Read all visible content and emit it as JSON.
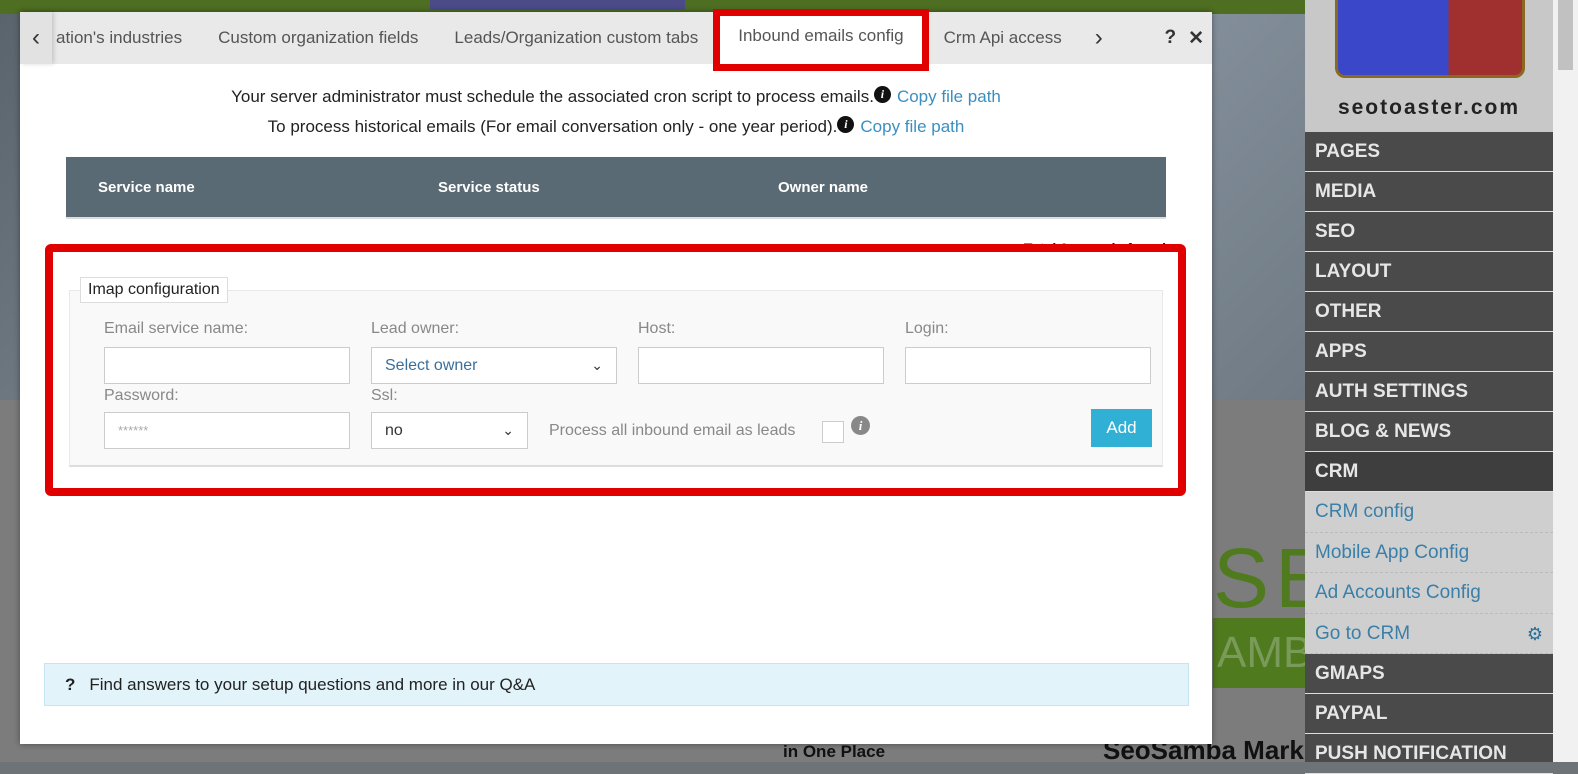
{
  "tabs": {
    "items": [
      "ation's industries",
      "Custom organization fields",
      "Leads/Organization custom tabs",
      "Inbound emails config",
      "Crm Api access"
    ],
    "active": "Inbound emails config",
    "help": "?",
    "close": "✕"
  },
  "info": {
    "line1": "Your server administrator must schedule the associated cron script to process emails.",
    "line2": "To process historical emails (For email conversation only - one year period).",
    "link": "Copy file path",
    "icon": "info-icon"
  },
  "table": {
    "headers": [
      "Service name",
      "Service status",
      "Owner name"
    ],
    "records": "Total 0 records found"
  },
  "imap": {
    "legend": "Imap configuration",
    "email_service_label": "Email service name:",
    "email_service_value": "",
    "lead_owner_label": "Lead owner:",
    "lead_owner_value": "Select owner",
    "host_label": "Host:",
    "host_value": "",
    "login_label": "Login:",
    "login_value": "",
    "password_label": "Password:",
    "password_value": "******",
    "ssl_label": "Ssl:",
    "ssl_value": "no",
    "process_label": "Process all inbound email as leads",
    "process_checked": false,
    "add": "Add"
  },
  "qa": {
    "icon": "?",
    "text": "Find answers to your setup questions and more in our Q&A"
  },
  "sidebar": {
    "logo": "seotoaster.com",
    "items": [
      "PAGES",
      "MEDIA",
      "SEO",
      "LAYOUT",
      "OTHER",
      "APPS",
      "AUTH SETTINGS",
      "BLOG & NEWS",
      "CRM"
    ],
    "crm_sub": [
      "CRM config",
      "Mobile App Config",
      "Ad Accounts Config",
      "Go to CRM"
    ],
    "items2": [
      "GMAPS",
      "PAYPAL",
      "PUSH NOTIFICATION"
    ]
  },
  "background": {
    "seo": "SEO",
    "amb": "AMB",
    "text1": "SeoSamba Mark",
    "text2": "in One Place"
  },
  "colors": {
    "highlight": "#e00000",
    "add_button": "#31b0d5",
    "table_header": "#5a6a74",
    "link": "#3a8fc0"
  }
}
